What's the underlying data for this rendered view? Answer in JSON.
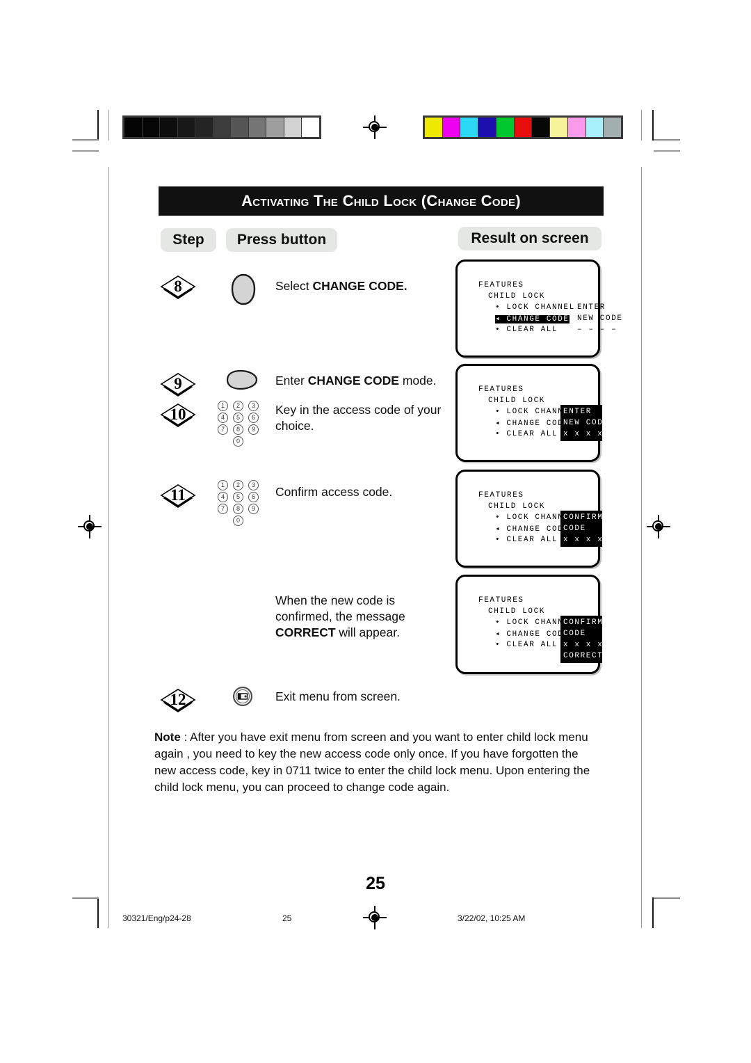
{
  "document": {
    "heading": "Activating the Child Lock (Change code)",
    "page_number": "25"
  },
  "column_headers": {
    "step": "Step",
    "press_button": "Press button",
    "result": "Result on screen"
  },
  "steps": [
    {
      "number": "8",
      "icon": "cursor-down-teardrop-icon",
      "text_html": "Select <b>CHANGE CODE.</b>",
      "text_plain": "Select CHANGE CODE."
    },
    {
      "number": "9",
      "icon": "cursor-right-teardrop-icon",
      "text_html": "Enter <b>CHANGE CODE</b> mode.",
      "text_plain": "Enter CHANGE CODE mode."
    },
    {
      "number": "10",
      "icon": "numeric-keypad-icon",
      "text_html": "Key in the access code of your choice.",
      "text_plain": "Key in the access code of your choice."
    },
    {
      "number": "11",
      "icon": "numeric-keypad-icon",
      "text_html": "Confirm access code.",
      "text_plain": "Confirm access code."
    },
    {
      "number": "",
      "icon": "",
      "text_html": "When the new code is confirmed, the message <b>CORRECT</b> will appear.",
      "text_plain": "When the new code is confirmed, the message CORRECT will appear."
    },
    {
      "number": "12",
      "icon": "menu-button-icon",
      "text_html": "Exit menu from screen.",
      "text_plain": "Exit menu from screen."
    }
  ],
  "keypad": {
    "rows": [
      [
        "1",
        "2",
        "3"
      ],
      [
        "4",
        "5",
        "6"
      ],
      [
        "7",
        "8",
        "9"
      ]
    ],
    "zero": "0"
  },
  "screens": [
    {
      "id": "screen-step-8",
      "title": "FEATURES",
      "submenu": "CHILD LOCK",
      "items": [
        {
          "bullet": "•",
          "label": "LOCK CHANNEL",
          "value": "ENTER",
          "highlight": "none"
        },
        {
          "bullet": "◂",
          "label": "CHANGE CODE",
          "value": "NEW CODE",
          "highlight": "label"
        },
        {
          "bullet": "•",
          "label": "CLEAR ALL",
          "value": "– – – –",
          "highlight": "none"
        }
      ],
      "value_block": null
    },
    {
      "id": "screen-step-9-10",
      "title": "FEATURES",
      "submenu": "CHILD LOCK",
      "items": [
        {
          "bullet": "•",
          "label": "LOCK CHANNEL",
          "value": "",
          "highlight": "none"
        },
        {
          "bullet": "◂",
          "label": "CHANGE CODE",
          "value": "",
          "highlight": "none"
        },
        {
          "bullet": "•",
          "label": "CLEAR ALL",
          "value": "",
          "highlight": "none"
        }
      ],
      "value_block": [
        "ENTER",
        "NEW CODE",
        "x x x x"
      ]
    },
    {
      "id": "screen-step-11",
      "title": "FEATURES",
      "submenu": "CHILD LOCK",
      "items": [
        {
          "bullet": "•",
          "label": "LOCK CHANNEL",
          "value": "",
          "highlight": "none"
        },
        {
          "bullet": "◂",
          "label": "CHANGE CODE",
          "value": "",
          "highlight": "none"
        },
        {
          "bullet": "•",
          "label": "CLEAR ALL",
          "value": "",
          "highlight": "none"
        }
      ],
      "value_block": [
        "CONFIRM",
        "CODE",
        "x x x x"
      ]
    },
    {
      "id": "screen-correct",
      "title": "FEATURES",
      "submenu": "CHILD LOCK",
      "items": [
        {
          "bullet": "•",
          "label": "LOCK CHANNEL",
          "value": "",
          "highlight": "none"
        },
        {
          "bullet": "◂",
          "label": "CHANGE CODE",
          "value": "",
          "highlight": "none"
        },
        {
          "bullet": "•",
          "label": "CLEAR ALL",
          "value": "",
          "highlight": "none"
        }
      ],
      "value_block": [
        "CONFIRM",
        "CODE",
        "x x x x",
        "CORRECT"
      ]
    }
  ],
  "note": {
    "label": "Note",
    "body": " :  After you have exit menu from screen and  you want to enter child lock menu again , you need to key the new access code only once. If you have forgotten the new access code, key in 0711 twice to enter the child lock menu. Upon entering the child lock menu, you can proceed to change code again."
  },
  "footer": {
    "left": "30321/Eng/p24-28",
    "center": "25",
    "right": "3/22/02, 10:25 AM"
  },
  "calibration": {
    "grayscale": [
      "#040404",
      "#060606",
      "#0d0d0d",
      "#181818",
      "#242424",
      "#3c3c3c",
      "#565656",
      "#757575",
      "#9e9e9e",
      "#d2d2d2",
      "#ffffff"
    ],
    "color": [
      "#edea00",
      "#ee00ee",
      "#2cd8f5",
      "#1c0fae",
      "#00c72e",
      "#e90e0e",
      "#070707",
      "#f7f39a",
      "#fb9ae8",
      "#a8f0fb",
      "#a3aeae"
    ]
  }
}
